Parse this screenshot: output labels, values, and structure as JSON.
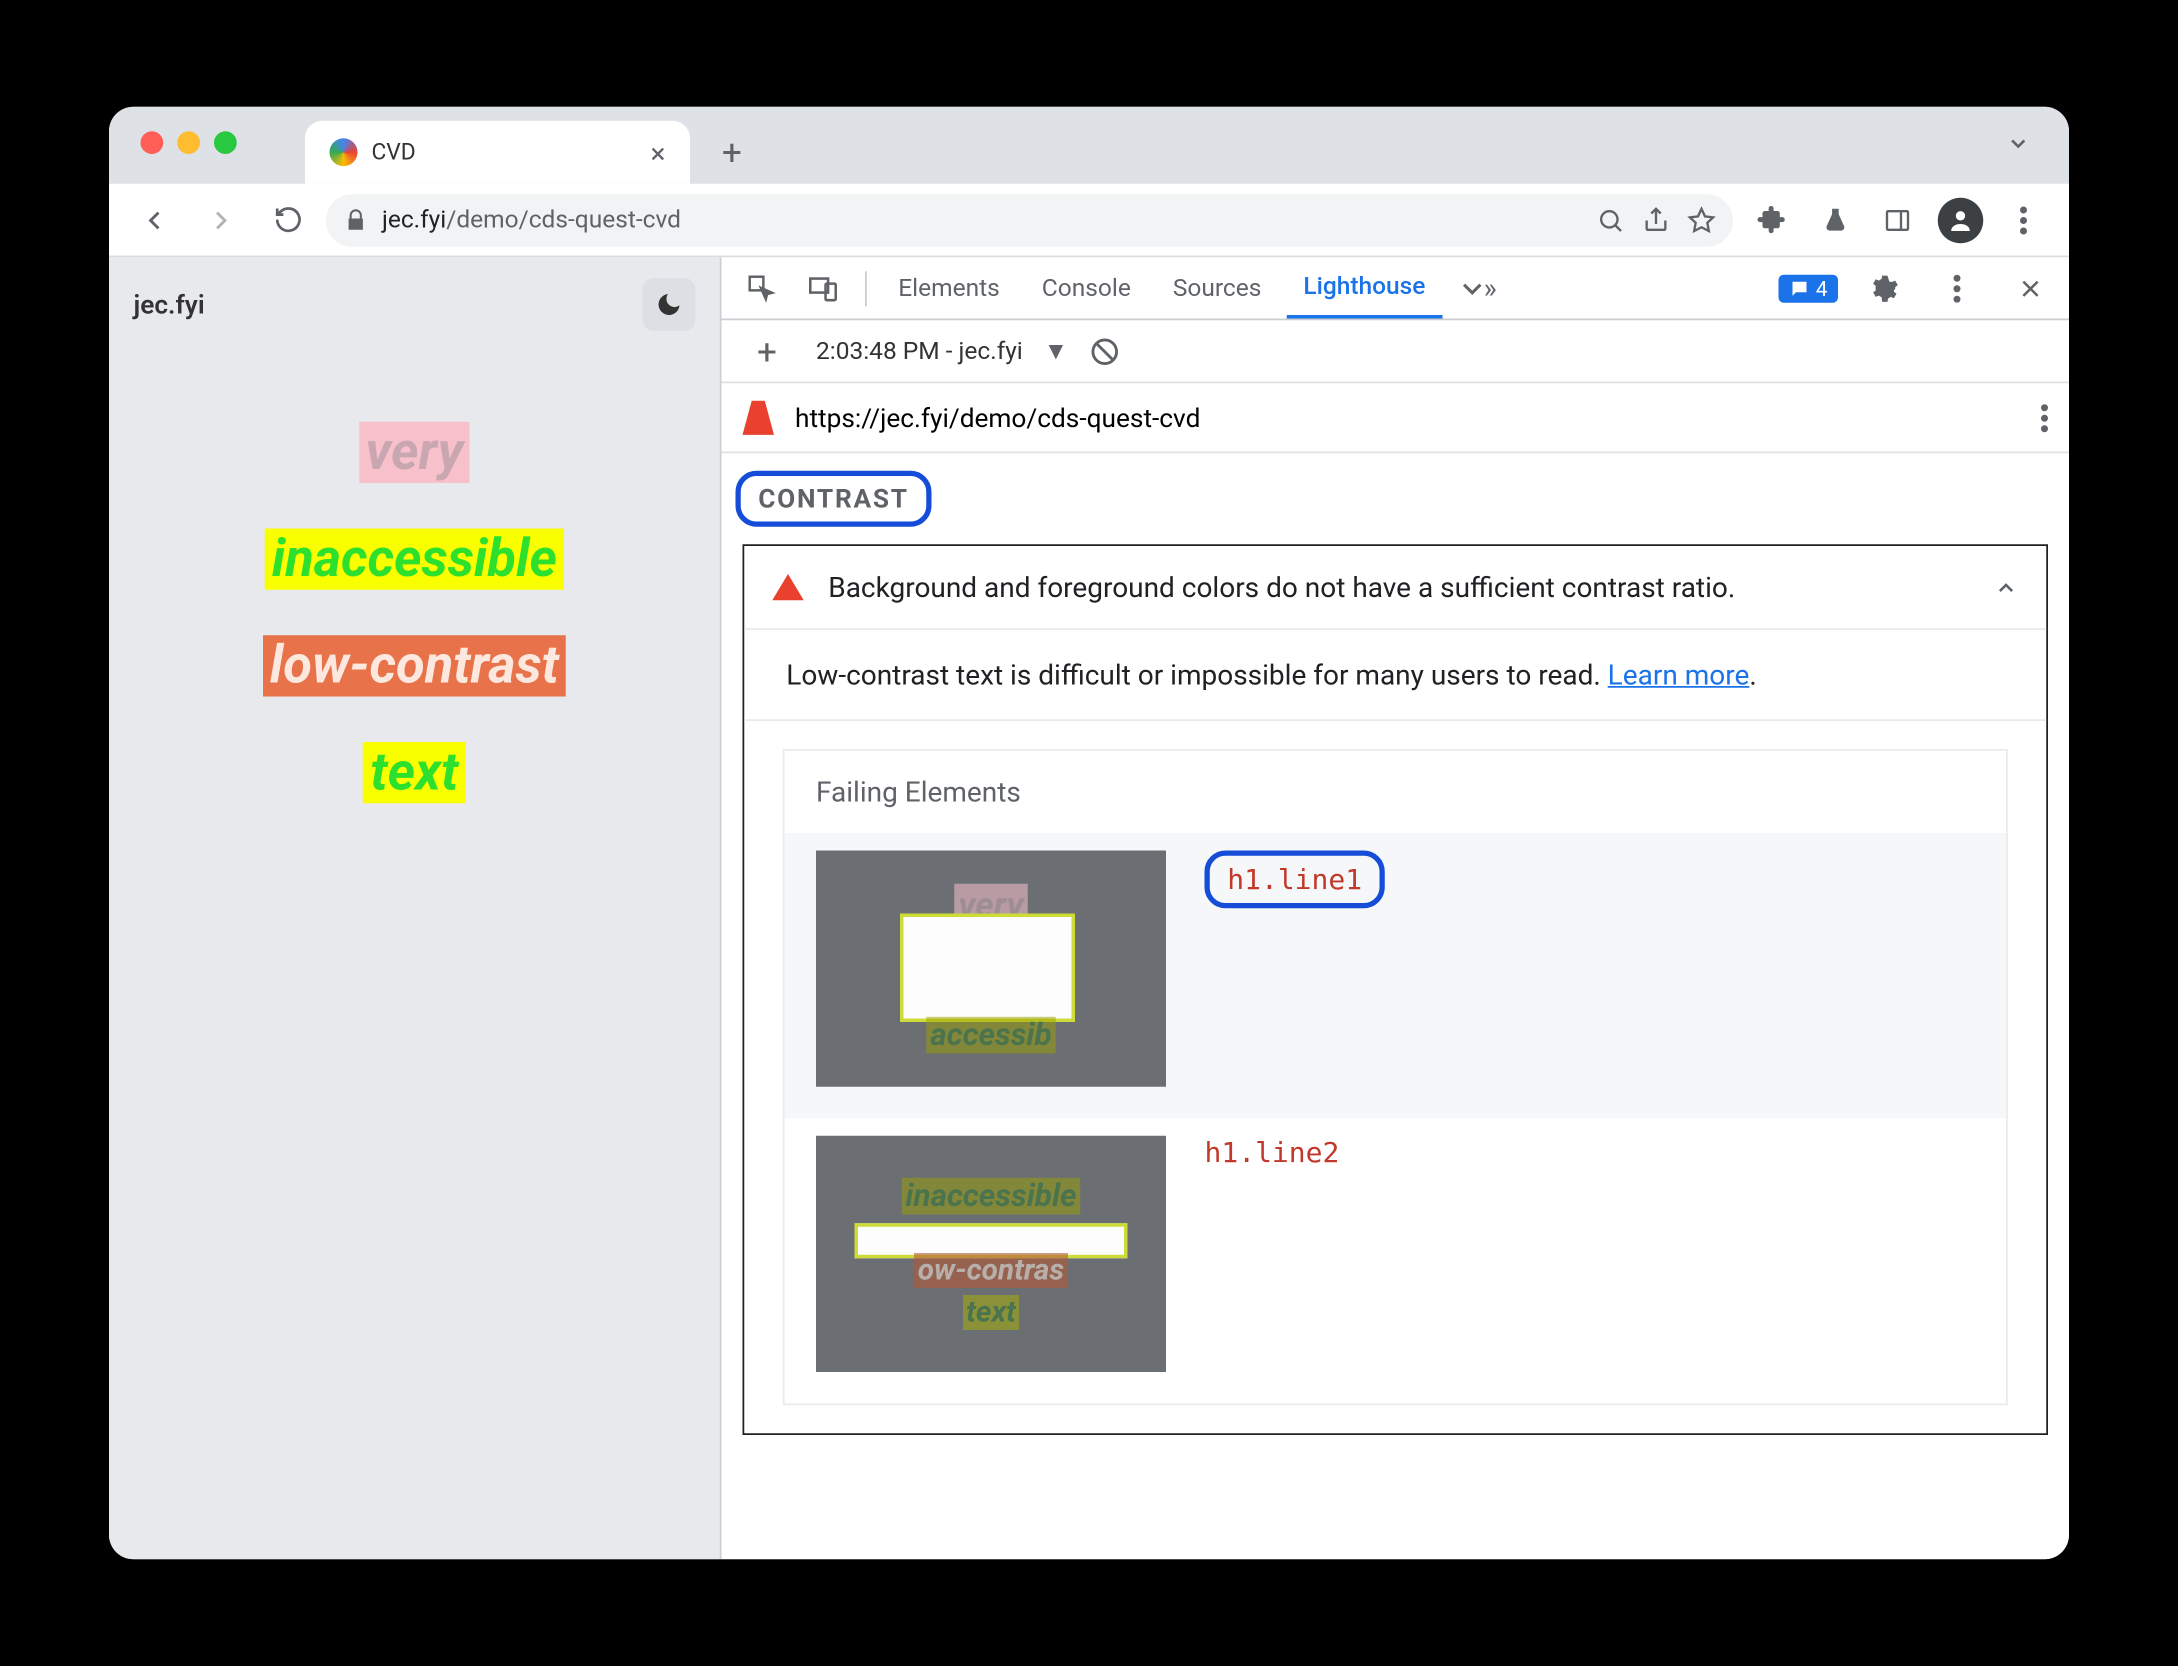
{
  "browser": {
    "tab_title": "CVD",
    "url_display": "jec.fyi",
    "url_path": "/demo/cds-quest-cvd"
  },
  "page": {
    "site_title": "jec.fyi",
    "line1": "very",
    "line2": "inaccessible",
    "line3": "low-contrast",
    "line4": "text"
  },
  "devtools": {
    "tabs": {
      "elements": "Elements",
      "console": "Console",
      "sources": "Sources",
      "lighthouse": "Lighthouse"
    },
    "messages_count": "4",
    "report_time": "2:03:48 PM - jec.fyi",
    "report_url": "https://jec.fyi/demo/cds-quest-cvd",
    "section_label": "CONTRAST",
    "audit_title": "Background and foreground colors do not have a sufficient contrast ratio.",
    "audit_desc": "Low-contrast text is difficult or impossible for many users to read. ",
    "learn_more": "Learn more",
    "failing_title": "Failing Elements",
    "failing": [
      {
        "selector": "h1.line1"
      },
      {
        "selector": "h1.line2"
      }
    ]
  }
}
